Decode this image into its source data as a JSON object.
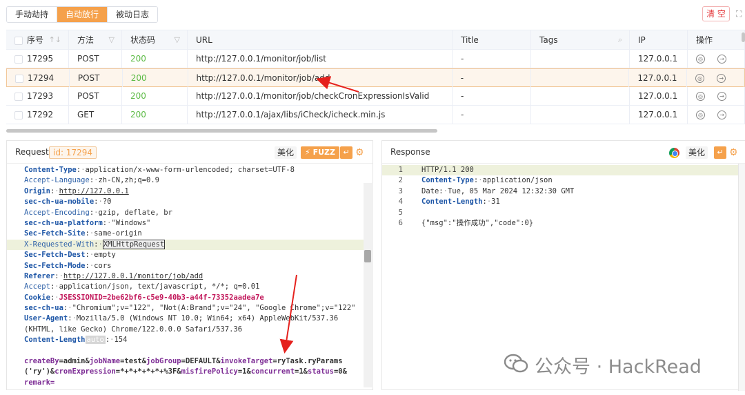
{
  "top_tabs": [
    {
      "label": "手动劫持",
      "active": false
    },
    {
      "label": "自动放行",
      "active": true
    },
    {
      "label": "被动日志",
      "active": false
    }
  ],
  "clear_label": "清 空",
  "table": {
    "headers": [
      "序号",
      "方法",
      "状态码",
      "URL",
      "Title",
      "Tags",
      "IP",
      "操作"
    ],
    "rows": [
      {
        "id": "17295",
        "method": "POST",
        "status": "200",
        "url": "http://127.0.0.1/monitor/job/list",
        "title": "-",
        "tags": "",
        "ip": "127.0.0.1"
      },
      {
        "id": "17294",
        "method": "POST",
        "status": "200",
        "url": "http://127.0.0.1/monitor/job/add",
        "title": "-",
        "tags": "",
        "ip": "127.0.0.1"
      },
      {
        "id": "17293",
        "method": "POST",
        "status": "200",
        "url": "http://127.0.0.1/monitor/job/checkCronExpressionIsValid",
        "title": "-",
        "tags": "",
        "ip": "127.0.0.1"
      },
      {
        "id": "17292",
        "method": "GET",
        "status": "200",
        "url": "http://127.0.0.1/ajax/libs/iCheck/icheck.min.js",
        "title": "-",
        "tags": "",
        "ip": "127.0.0.1"
      }
    ]
  },
  "request": {
    "title": "Request",
    "id_badge": "id: 17294",
    "beautify_label": "美化",
    "fuzz_label": "FUZZ",
    "lines": [
      {
        "k": "Content-Type",
        "v": "application/x-www-form-urlencoded; charset=UTF-8",
        "style": "bold"
      },
      {
        "k": "Accept-Language",
        "v": "zh-CN,zh;q=0.9",
        "style": "normal"
      },
      {
        "k": "Origin",
        "v": "http://127.0.0.1",
        "style": "bold",
        "underline": true
      },
      {
        "k": "sec-ch-ua-mobile",
        "v": "?0",
        "style": "bold"
      },
      {
        "k": "Accept-Encoding",
        "v": "gzip, deflate, br",
        "style": "normal"
      },
      {
        "k": "sec-ch-ua-platform",
        "v": "\"Windows\"",
        "style": "bold"
      },
      {
        "k": "Sec-Fetch-Site",
        "v": "same-origin",
        "style": "bold"
      },
      {
        "k": "X-Requested-With",
        "v": "XMLHttpRequest",
        "style": "normal",
        "highlight": true,
        "selected": true
      },
      {
        "k": "Sec-Fetch-Dest",
        "v": "empty",
        "style": "bold"
      },
      {
        "k": "Sec-Fetch-Mode",
        "v": "cors",
        "style": "bold"
      },
      {
        "k": "Referer",
        "v": "http://127.0.0.1/monitor/job/add",
        "style": "bold",
        "underline": true
      },
      {
        "k": "Accept",
        "v": "application/json, text/javascript, */*; q=0.01",
        "style": "normal"
      },
      {
        "k": "Cookie",
        "v": "JSESSIONID=2be62bf6-c5e9-40b3-a44f-73352aadea7e",
        "style": "bold",
        "session": true
      },
      {
        "k": "sec-ch-ua",
        "v": "\"Chromium\";v=\"122\", \"Not(A:Brand\";v=\"24\", \"Google Chrome\";v=\"122\"",
        "style": "bold"
      },
      {
        "k": "User-Agent",
        "v": "Mozilla/5.0 (Windows NT 10.0; Win64; x64) AppleWebKit/537.36",
        "style": "bold"
      },
      {
        "k": "",
        "v": "(KHTML, like Gecko) Chrome/122.0.0.0 Safari/537.36",
        "style": "cont"
      },
      {
        "k": "Content-Length",
        "v": "154",
        "style": "bold",
        "auto": "auto"
      },
      {
        "k": "",
        "v": "",
        "style": "blank"
      }
    ],
    "body_line1": [
      [
        "createBy",
        "admin"
      ],
      [
        "jobName",
        "test"
      ],
      [
        "jobGroup",
        "DEFAULT"
      ],
      [
        "invokeTarget",
        "ryTask.ryParams"
      ]
    ],
    "body_line2_prefix": "('ry')",
    "body_line2": [
      [
        "cronExpression",
        "*+*+*+*+*+%3F"
      ],
      [
        "misfirePolicy",
        "1"
      ],
      [
        "concurrent",
        "1"
      ],
      [
        "status",
        "0"
      ]
    ],
    "body_line3": "remark="
  },
  "response": {
    "title": "Response",
    "beautify_label": "美化",
    "lines": [
      {
        "n": "1",
        "text": "HTTP/1.1 200",
        "highlight": true
      },
      {
        "n": "2",
        "k": "Content-Type",
        "v": "application/json"
      },
      {
        "n": "3",
        "k": "Date",
        "v": "Tue, 05 Mar 2024 12:32:30 GMT",
        "plain": true
      },
      {
        "n": "4",
        "k": "Content-Length",
        "v": "31"
      },
      {
        "n": "5",
        "text": ""
      },
      {
        "n": "6",
        "text": "{\"msg\":\"操作成功\",\"code\":0}"
      }
    ]
  },
  "watermark": "公众号 · HackRead"
}
